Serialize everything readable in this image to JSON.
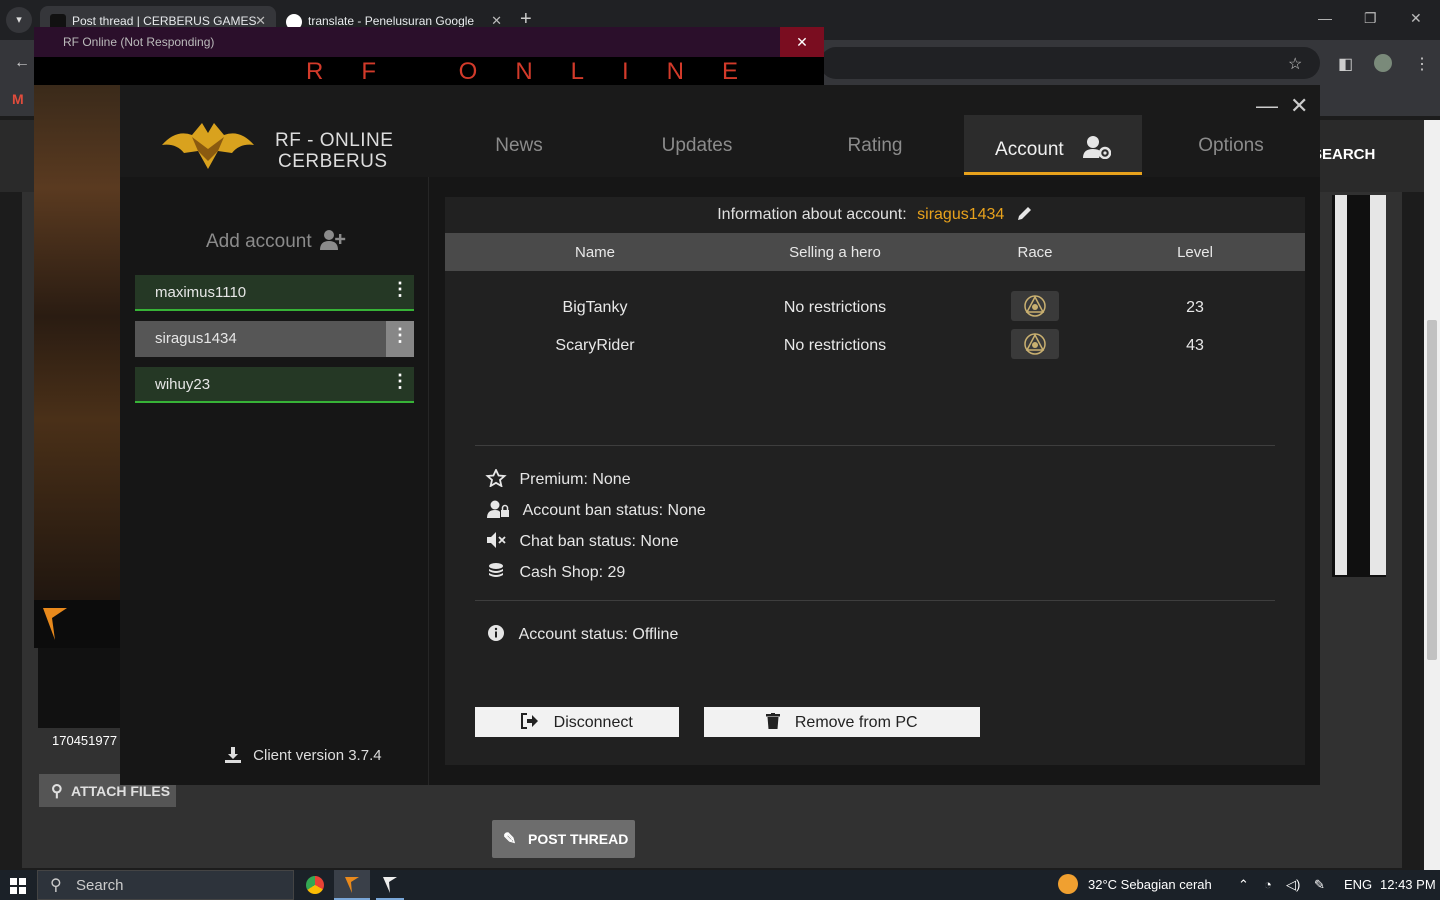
{
  "browser": {
    "tabs": [
      {
        "title": "Post thread | CERBERUS GAMES",
        "active": true
      },
      {
        "title": "translate - Penelusuran Google",
        "active": false
      }
    ],
    "new_tab": "+"
  },
  "website": {
    "search_label": "SEARCH",
    "attach_files": "ATTACH FILES",
    "post_thread": "POST THREAD",
    "thumbnail_caption": "170451977"
  },
  "game_window": {
    "title": "RF Online (Not Responding)",
    "logo_text": "RF ONLINE"
  },
  "launcher": {
    "brand": {
      "line1": "RF - ONLINE",
      "line2": "CERBERUS"
    },
    "nav": [
      {
        "label": "News",
        "active": false
      },
      {
        "label": "Updates",
        "active": false
      },
      {
        "label": "Rating",
        "active": false
      },
      {
        "label": "Account",
        "active": true
      },
      {
        "label": "Options",
        "active": false
      }
    ],
    "sidebar": {
      "add_account": "Add account",
      "accounts": [
        {
          "name": "maximus1110",
          "state": "green"
        },
        {
          "name": "siragus1434",
          "state": "selected"
        },
        {
          "name": "wihuy23",
          "state": "green"
        }
      ],
      "client_version": "Client version 3.7.4"
    },
    "account_panel": {
      "info_label": "Information about account:",
      "account_name": "siragus1434",
      "columns": [
        "Name",
        "Selling a hero",
        "Race",
        "Level"
      ],
      "rows": [
        {
          "name": "BigTanky",
          "selling": "No restrictions",
          "race_icon": "race-emblem-icon",
          "level": "23"
        },
        {
          "name": "ScaryRider",
          "selling": "No restrictions",
          "race_icon": "race-emblem-icon",
          "level": "43"
        }
      ],
      "stats": [
        {
          "icon": "star-icon",
          "text": "Premium: None"
        },
        {
          "icon": "user-lock-icon",
          "text": "Account ban status: None"
        },
        {
          "icon": "mute-icon",
          "text": "Chat ban status: None"
        },
        {
          "icon": "coins-icon",
          "text": "Cash Shop: 29"
        }
      ],
      "status": {
        "icon": "info-icon",
        "text": "Account status: Offline"
      },
      "buttons": {
        "disconnect": "Disconnect",
        "remove": "Remove from PC"
      }
    },
    "accent_color": "#e8a21c"
  },
  "taskbar": {
    "search": "Search",
    "weather": "32°C  Sebagian cerah",
    "language": "ENG",
    "time": "12:43 PM"
  }
}
